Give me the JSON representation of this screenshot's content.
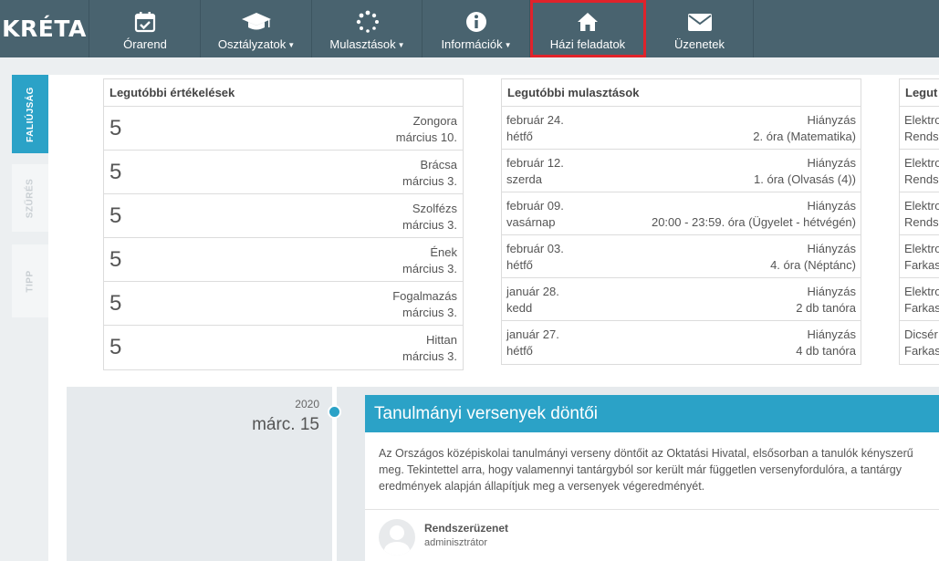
{
  "brand": {
    "logo_text": "KRÉTA"
  },
  "nav": [
    {
      "label": "Órarend",
      "icon": "calendar-check-icon",
      "dropdown": false,
      "active": false
    },
    {
      "label": "Osztályzatok",
      "icon": "graduation-cap-icon",
      "dropdown": true,
      "active": false
    },
    {
      "label": "Mulasztások",
      "icon": "spinner-dots-icon",
      "dropdown": true,
      "active": false
    },
    {
      "label": "Információk",
      "icon": "info-circle-icon",
      "dropdown": true,
      "active": false
    },
    {
      "label": "Házi feladatok",
      "icon": "home-icon",
      "dropdown": false,
      "active": true
    },
    {
      "label": "Üzenetek",
      "icon": "envelope-icon",
      "dropdown": false,
      "active": false
    }
  ],
  "sidebar": {
    "tabs": [
      {
        "label": "FALIÚJSÁG",
        "active": true
      },
      {
        "label": "SZŰRÉS",
        "active": false
      },
      {
        "label": "TIPP",
        "active": false
      }
    ]
  },
  "grades_panel": {
    "title": "Legutóbbi értékelések",
    "rows": [
      {
        "grade": "5",
        "subject": "Zongora",
        "date": "március 10."
      },
      {
        "grade": "5",
        "subject": "Brácsa",
        "date": "március 3."
      },
      {
        "grade": "5",
        "subject": "Szolfézs",
        "date": "március 3."
      },
      {
        "grade": "5",
        "subject": "Ének",
        "date": "március 3."
      },
      {
        "grade": "5",
        "subject": "Fogalmazás",
        "date": "március 3."
      },
      {
        "grade": "5",
        "subject": "Hittan",
        "date": "március 3."
      }
    ]
  },
  "absences_panel": {
    "title": "Legutóbbi mulasztások",
    "rows": [
      {
        "date": "február 24.",
        "day": "hétfő",
        "type": "Hiányzás",
        "detail": "2. óra (Matematika)"
      },
      {
        "date": "február 12.",
        "day": "szerda",
        "type": "Hiányzás",
        "detail": "1. óra (Olvasás (4))"
      },
      {
        "date": "február 09.",
        "day": "vasárnap",
        "type": "Hiányzás",
        "detail": "20:00 - 23:59. óra (Ügyelet - hétvégén)"
      },
      {
        "date": "február 03.",
        "day": "hétfő",
        "type": "Hiányzás",
        "detail": "4. óra (Néptánc)"
      },
      {
        "date": "január 28.",
        "day": "kedd",
        "type": "Hiányzás",
        "detail": "2 db tanóra"
      },
      {
        "date": "január 27.",
        "day": "hétfő",
        "type": "Hiányzás",
        "detail": "4 db tanóra"
      }
    ]
  },
  "third_panel": {
    "title": "Legut",
    "rows": [
      {
        "line1": "Elektro",
        "line2": "Rendsz"
      },
      {
        "line1": "Elektro",
        "line2": "Rendsz"
      },
      {
        "line1": "Elektro",
        "line2": "Rendsz"
      },
      {
        "line1": "Elektro",
        "line2": "Farkas"
      },
      {
        "line1": "Elektro",
        "line2": "Farkas"
      },
      {
        "line1": "Dicsér",
        "line2": "Farkas"
      }
    ]
  },
  "timeline": {
    "year": "2020",
    "date": "márc. 15",
    "post": {
      "title": "Tanulmányi versenyek döntői",
      "body_lines": [
        "Az Országos középiskolai tanulmányi verseny döntőit az Oktatási Hivatal, elsősorban a tanulók kényszerű",
        "meg. Tekintettel arra, hogy valamennyi tantárgyból sor került már független versenyfordulóra, a tantárgy",
        "eredmények alapján állapítjuk meg a versenyek végeredményét."
      ],
      "author": "Rendszerüzenet",
      "role": "adminisztrátor"
    }
  },
  "colors": {
    "nav_bg": "#49636f",
    "accent": "#2ba2c7",
    "highlight": "#e0232b"
  }
}
